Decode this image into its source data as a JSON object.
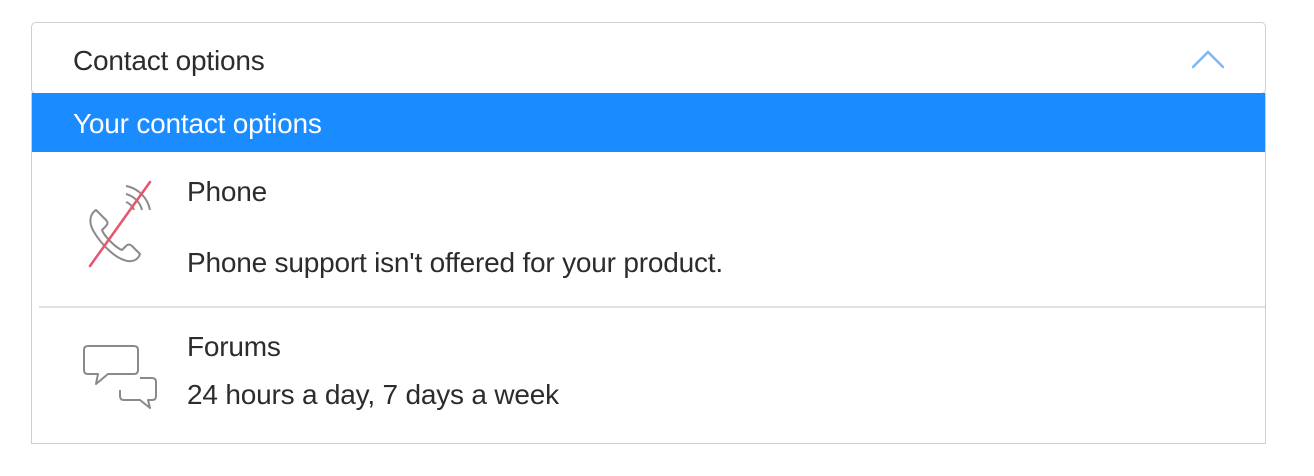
{
  "accordion": {
    "title": "Contact options",
    "expanded": true,
    "chevron_icon": "chevron-up-icon",
    "chevron_color": "#7fb8f5"
  },
  "section": {
    "label": "Your contact options",
    "background": "#1a8cff"
  },
  "options": [
    {
      "icon": "phone-unavailable-icon",
      "title": "Phone",
      "description": "Phone support isn't offered for your product.",
      "strike_color": "#e8546b"
    },
    {
      "icon": "forum-bubbles-icon",
      "title": "Forums",
      "description": "24 hours a day, 7 days a week"
    }
  ]
}
